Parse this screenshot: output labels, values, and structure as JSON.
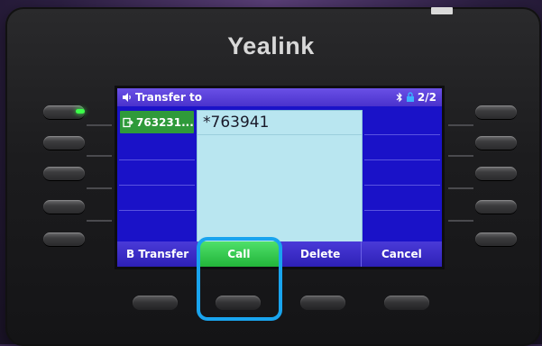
{
  "device": {
    "brand": "Yealink"
  },
  "screen": {
    "title": "Transfer to",
    "page_indicator": "2/2",
    "line_key_label": "763231...",
    "dial_entry": "*763941"
  },
  "softkeys": [
    {
      "label": "B Transfer"
    },
    {
      "label": "Call",
      "active": true
    },
    {
      "label": "Delete"
    },
    {
      "label": "Cancel"
    }
  ],
  "icons": {
    "speaker": "speaker-icon",
    "bluetooth": "bluetooth-icon",
    "lock": "lock-icon",
    "transfer": "transfer-icon"
  },
  "colors": {
    "screen_bg": "#1a12c8",
    "call_key": "#2fc34a",
    "highlight": "#19a4ee",
    "line_led": "#3cff4a"
  }
}
